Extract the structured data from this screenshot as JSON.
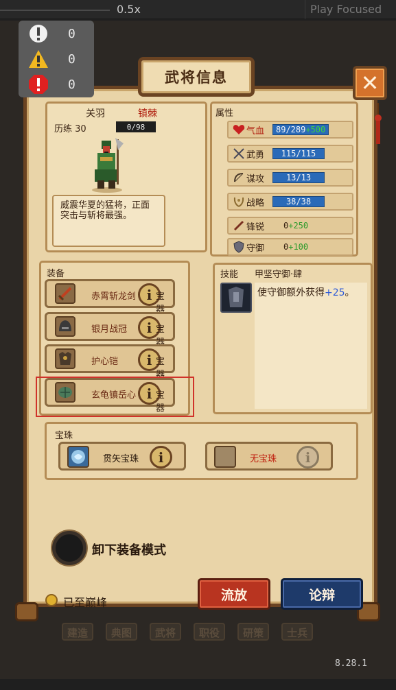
{
  "editor": {
    "zoom": "0.5x",
    "play_mode": "Play Focused",
    "version": "8.28.1"
  },
  "console": {
    "info_count": "0",
    "warning_count": "0",
    "error_count": "0"
  },
  "panel": {
    "title": "武将信息",
    "close_label": "✕"
  },
  "hero": {
    "name": "关羽",
    "rank": "镇棘",
    "exp_label": "历练 30",
    "exp_value": "0/98",
    "description": "威震华夏的猛将，正面突击与斩将最强。"
  },
  "attributes": {
    "title": "属性",
    "hp": {
      "label": "气血",
      "value": "89/289",
      "bonus": "+500"
    },
    "courage": {
      "label": "武勇",
      "value": "115/115"
    },
    "tactics": {
      "label": "谋攻",
      "value": "13/13"
    },
    "strategy": {
      "label": "战略",
      "value": "38/38"
    },
    "sharpness": {
      "label": "锋锐",
      "value": "0",
      "bonus": "+250"
    },
    "defense": {
      "label": "守御",
      "value": "0",
      "bonus": "+100"
    }
  },
  "equipment": {
    "title": "装备",
    "items": [
      {
        "name": "赤霄斩龙剑",
        "tag": "宝器",
        "icon": "sword-icon"
      },
      {
        "name": "银月战冠",
        "tag": "宝器",
        "icon": "helmet-icon"
      },
      {
        "name": "护心铠",
        "tag": "宝器",
        "icon": "armor-icon"
      },
      {
        "name": "玄龟镇岳心",
        "tag": "宝器",
        "icon": "shell-icon"
      }
    ],
    "info_glyph": "i"
  },
  "skill": {
    "heading": "技能",
    "name": "甲坚守御·肆",
    "description": "使守御额外获得",
    "bonus": "+25",
    "suffix": "。"
  },
  "orbs": {
    "title": "宝珠",
    "slots": [
      {
        "name": "贯矢宝珠",
        "color": "#2a1a0e"
      },
      {
        "name": "无宝珠",
        "color": "#c02010"
      }
    ],
    "info_glyph": "i"
  },
  "controls": {
    "unequip_mode": "卸下装备模式",
    "peak": "已至巅峰",
    "exile": "流放",
    "debate": "论辩"
  },
  "bottom_nav": [
    "建造",
    "典图",
    "武将",
    "职役",
    "研策",
    "士兵"
  ]
}
